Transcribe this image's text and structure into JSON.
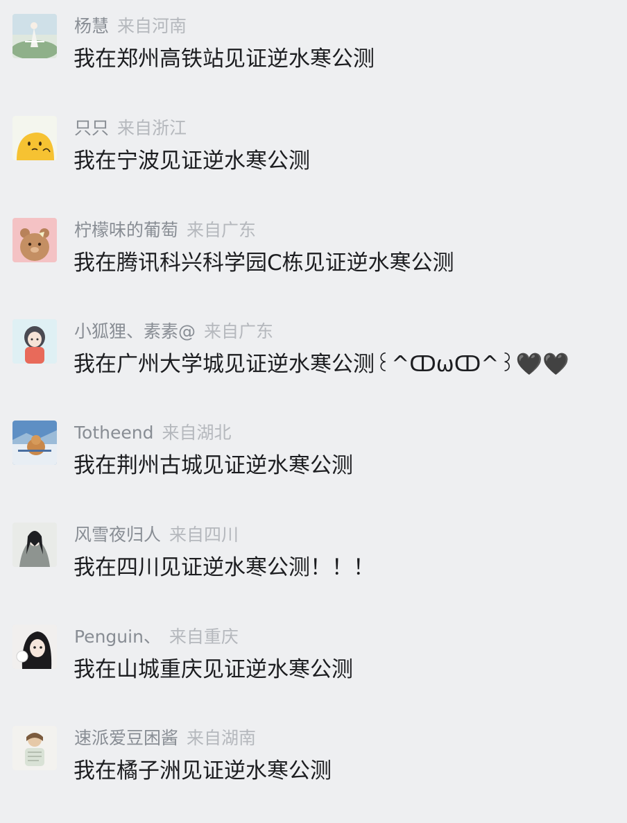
{
  "comments": [
    {
      "username": "杨慧",
      "location": "来自河南",
      "text": "我在郑州高铁站见证逆水寒公测",
      "avatar_icon": "landscape-figure-avatar-icon"
    },
    {
      "username": "只只",
      "location": "来自浙江",
      "text": "我在宁波见证逆水寒公测",
      "avatar_icon": "yellow-blob-avatar-icon"
    },
    {
      "username": "柠檬味的葡萄",
      "location": "来自广东",
      "text": "我在腾讯科兴科学园C栋见证逆水寒公测",
      "avatar_icon": "cartoon-bear-avatar-icon"
    },
    {
      "username": "小狐狸、素素@",
      "location": "来自广东",
      "text": "我在广州大学城见证逆水寒公测꒰^ↀωↀ^꒱🖤🖤",
      "avatar_icon": "anime-girl-avatar-icon"
    },
    {
      "username": "Totheend",
      "location": "来自湖北",
      "text": "我在荆州古城见证逆水寒公测",
      "avatar_icon": "snow-dog-avatar-icon"
    },
    {
      "username": "风雪夜归人",
      "location": "来自四川",
      "text": "我在四川见证逆水寒公测！！！",
      "avatar_icon": "ink-swordsman-avatar-icon"
    },
    {
      "username": "Penguin、",
      "location": "来自重庆",
      "text": "我在山城重庆见证逆水寒公测",
      "avatar_icon": "girl-portrait-avatar-icon"
    },
    {
      "username": "速派爱豆困酱",
      "location": "来自湖南",
      "text": "我在橘子洲见证逆水寒公测",
      "avatar_icon": "sketch-figure-avatar-icon"
    }
  ]
}
